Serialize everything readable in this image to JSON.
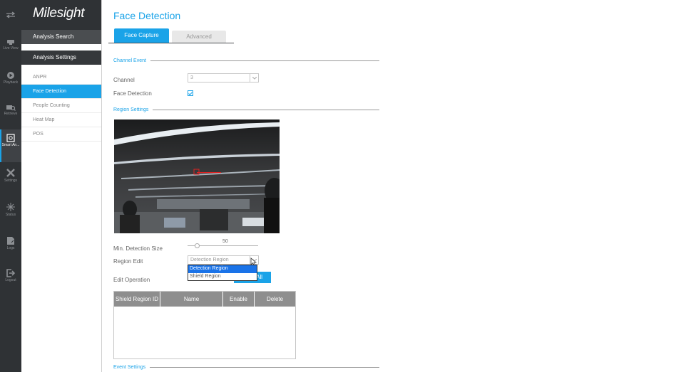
{
  "brand": "Milesight",
  "rail": {
    "items": [
      {
        "label": "Live View",
        "icon": "camera-icon"
      },
      {
        "label": "Playback",
        "icon": "playback-icon"
      },
      {
        "label": "Retrieve",
        "icon": "retrieve-icon"
      },
      {
        "label": "Smart An...",
        "icon": "smart-analysis-icon"
      },
      {
        "label": "Settings",
        "icon": "settings-icon"
      },
      {
        "label": "Status",
        "icon": "status-icon"
      },
      {
        "label": "Logs",
        "icon": "logs-icon"
      },
      {
        "label": "Logout",
        "icon": "logout-icon"
      }
    ],
    "active": "Smart An..."
  },
  "sidebar": {
    "group1": "Analysis Search",
    "group2": "Analysis Settings",
    "items": [
      "ANPR",
      "Face Detection",
      "People Counting",
      "Heat Map",
      "POS"
    ],
    "active": "Face Detection"
  },
  "page": {
    "title": "Face Detection",
    "tabs": [
      "Face Capture",
      "Advanced"
    ],
    "active_tab": "Face Capture"
  },
  "channel_event": {
    "section": "Channel Event",
    "channel_label": "Channel",
    "channel_value": "3",
    "face_detection_label": "Face Detection",
    "face_detection_checked": true
  },
  "region_settings": {
    "section": "Region Settings",
    "min_size_label": "Min. Detection Size",
    "min_size_value": "50",
    "min_size_fraction": 0.14,
    "region_edit_label": "Region Edit",
    "region_edit_value": "Detection Region",
    "region_options": [
      "Detection Region",
      "Shield Region"
    ],
    "region_selected": "Detection Region",
    "edit_operation_label": "Edit Operation",
    "delete_all_label": "All"
  },
  "shield_table": {
    "columns": [
      "Shield Region ID",
      "Name",
      "Enable",
      "Delete"
    ],
    "rows": []
  },
  "event_settings": {
    "section": "Event Settings"
  },
  "colors": {
    "accent": "#1aa3e8",
    "rail_bg": "#2f3235",
    "table_header": "#8e8e8e"
  }
}
